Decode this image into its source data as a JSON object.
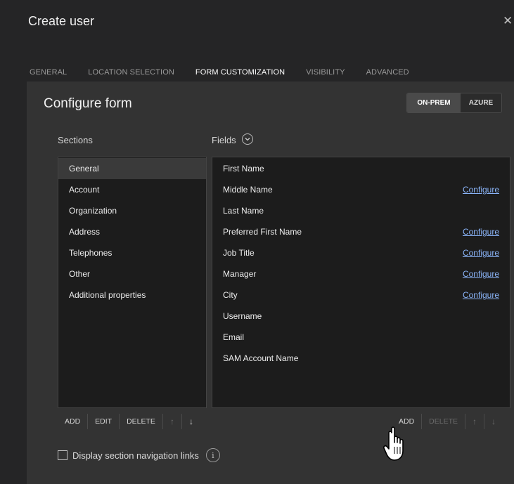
{
  "dialog": {
    "title": "Create user",
    "close_glyph": "✕"
  },
  "tabs": [
    {
      "label": "GENERAL",
      "active": false
    },
    {
      "label": "LOCATION SELECTION",
      "active": false
    },
    {
      "label": "FORM CUSTOMIZATION",
      "active": true
    },
    {
      "label": "VISIBILITY",
      "active": false
    },
    {
      "label": "ADVANCED",
      "active": false
    }
  ],
  "panel": {
    "title": "Configure form",
    "mode_toggle": {
      "on_prem": "ON-PREM",
      "azure": "AZURE",
      "selected": "ON-PREM"
    }
  },
  "sections": {
    "label": "Sections",
    "selected": "General",
    "items": [
      "General",
      "Account",
      "Organization",
      "Address",
      "Telephones",
      "Other",
      "Additional properties"
    ],
    "toolbar": {
      "add": "ADD",
      "edit": "EDIT",
      "delete": "DELETE",
      "up": "↑",
      "down": "↓"
    }
  },
  "fields": {
    "label": "Fields",
    "toggle_icon": "chevron-down-circle-icon",
    "items": [
      {
        "name": "First Name",
        "link": ""
      },
      {
        "name": "Middle Name",
        "link": "Configure"
      },
      {
        "name": "Last Name",
        "link": ""
      },
      {
        "name": "Preferred First Name",
        "link": "Configure"
      },
      {
        "name": "Job Title",
        "link": "Configure"
      },
      {
        "name": "Manager",
        "link": "Configure"
      },
      {
        "name": "City",
        "link": "Configure"
      },
      {
        "name": "Username",
        "link": ""
      },
      {
        "name": "Email",
        "link": ""
      },
      {
        "name": "SAM Account Name",
        "link": ""
      }
    ],
    "toolbar": {
      "add": "ADD",
      "delete": "DELETE",
      "up": "↑",
      "down": "↓"
    }
  },
  "options": {
    "display_nav_links": {
      "label": "Display section navigation links",
      "checked": false
    },
    "info_glyph": "i"
  },
  "colors": {
    "background": "#252526",
    "panel": "#333333",
    "list": "#1c1c1c",
    "link": "#8ab4f8"
  }
}
